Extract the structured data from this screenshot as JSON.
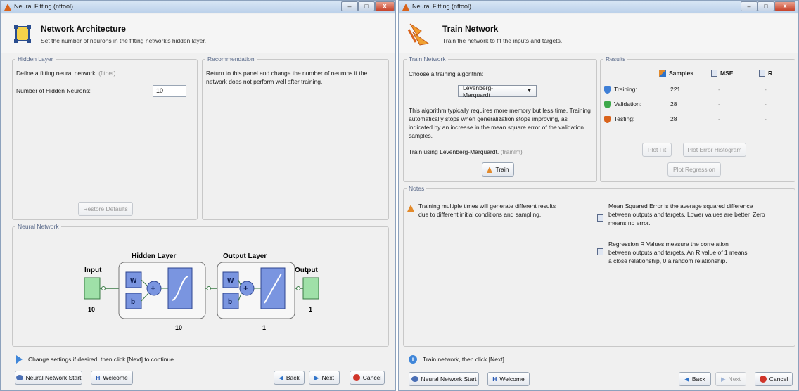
{
  "left_window": {
    "title": "Neural Fitting (nftool)",
    "header": {
      "title": "Network Architecture",
      "subtitle": "Set the number of neurons in the fitting network's hidden layer."
    },
    "hidden_layer": {
      "legend": "Hidden Layer",
      "define_text": "Define a fitting neural network.",
      "define_fn": "(fitnet)",
      "neurons_label": "Number of Hidden Neurons:",
      "neurons_value": "10",
      "restore_label": "Restore Defaults"
    },
    "recommendation": {
      "legend": "Recommendation",
      "text": "Return to this panel and change the number of neurons if the network does not perform well after training."
    },
    "neural_network": {
      "legend": "Neural Network",
      "input_label": "Input",
      "input_size": "10",
      "hidden_layer_label": "Hidden Layer",
      "hidden_size": "10",
      "output_layer_label": "Output Layer",
      "output_size": "1",
      "output_label": "Output",
      "output_count": "1",
      "w_label": "W",
      "b_label": "b"
    },
    "footer": {
      "message": "Change settings if desired, then click [Next] to continue.",
      "nn_start": "Neural Network Start",
      "welcome": "Welcome",
      "back": "Back",
      "next": "Next",
      "cancel": "Cancel"
    }
  },
  "right_window": {
    "title": "Neural Fitting (nftool)",
    "header": {
      "title": "Train Network",
      "subtitle": "Train the network to fit the inputs and targets."
    },
    "train_network": {
      "legend": "Train Network",
      "choose_label": "Choose a training algorithm:",
      "algorithm": "Levenberg-Marquardt",
      "description": "This algorithm typically requires more memory but less time. Training automatically stops when generalization stops improving, as indicated by an increase in the mean square error of the validation samples.",
      "train_using": "Train using Levenberg-Marquardt.",
      "train_fn": "(trainlm)",
      "train_button": "Train"
    },
    "results": {
      "legend": "Results",
      "col_samples": "Samples",
      "col_mse": "MSE",
      "col_r": "R",
      "rows": [
        {
          "label": "Training:",
          "samples": "221",
          "mse": "-",
          "r": "-"
        },
        {
          "label": "Validation:",
          "samples": "28",
          "mse": "-",
          "r": "-"
        },
        {
          "label": "Testing:",
          "samples": "28",
          "mse": "-",
          "r": "-"
        }
      ],
      "plot_fit": "Plot Fit",
      "plot_error_hist": "Plot Error Histogram",
      "plot_regression": "Plot Regression"
    },
    "notes": {
      "legend": "Notes",
      "note1": "Training multiple times will generate different results due to different initial conditions and sampling.",
      "note2": "Mean Squared Error is the average squared difference between outputs and targets. Lower values are better. Zero means no error.",
      "note3": "Regression R Values measure the correlation between outputs and targets. An R value of 1 means a close relationship, 0 a random relationship."
    },
    "footer": {
      "message": "Train network, then click [Next].",
      "nn_start": "Neural Network Start",
      "welcome": "Welcome",
      "back": "Back",
      "next": "Next",
      "cancel": "Cancel"
    }
  },
  "colors": {
    "block_green": "#9fe0a8",
    "block_blue": "#7a95e0",
    "legend_text": "#5a6a8a",
    "cancel_red": "#d0352a",
    "info_blue": "#3f86d9"
  }
}
